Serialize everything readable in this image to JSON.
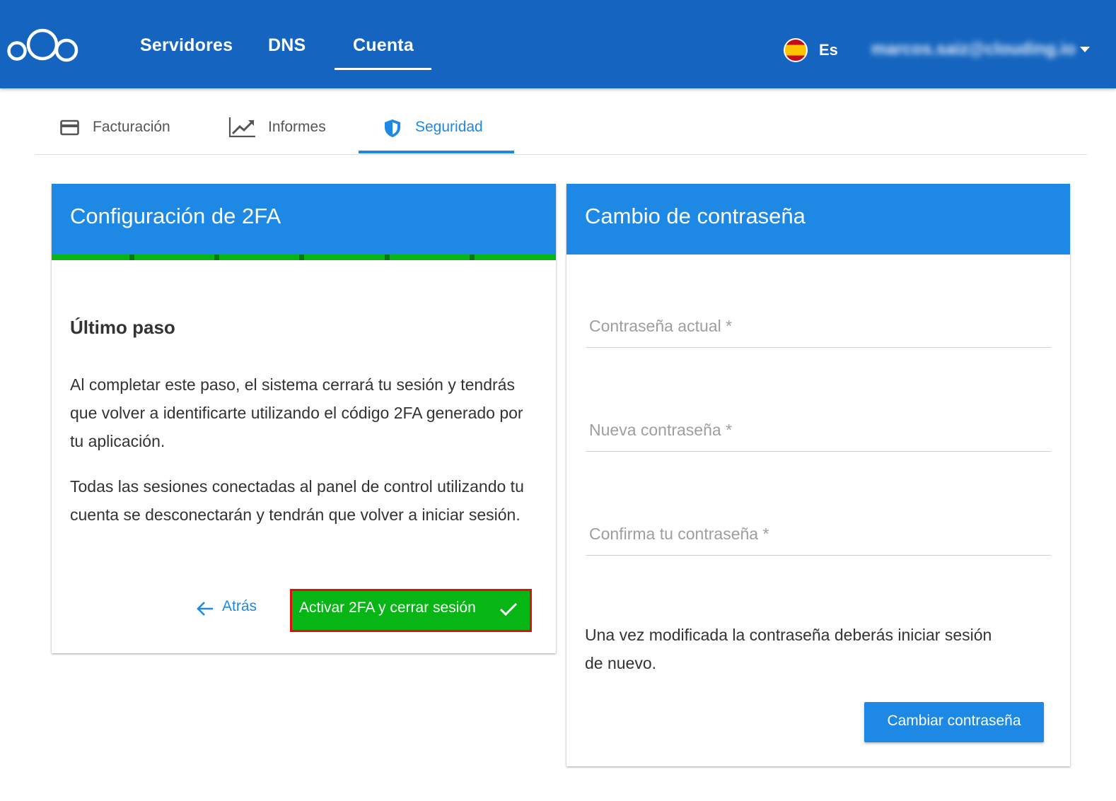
{
  "topbar": {
    "logo_icon": "cloud-circles-logo-icon",
    "nav": [
      {
        "label": "Servidores"
      },
      {
        "label": "DNS"
      },
      {
        "label": "Cuenta"
      }
    ],
    "active_nav": "Cuenta",
    "language": {
      "flag_icon": "spain-flag-icon",
      "label": "Es"
    },
    "user": {
      "email": "marcos.saiz@clouding.io",
      "caret_icon": "caret-down-icon"
    }
  },
  "subtabs": [
    {
      "label": "Facturación",
      "icon": "credit-card-icon"
    },
    {
      "label": "Informes",
      "icon": "trending-chart-icon"
    },
    {
      "label": "Seguridad",
      "icon": "shield-icon"
    }
  ],
  "active_subtab": "Seguridad",
  "twofa_card": {
    "title": "Configuración de 2FA",
    "progress_steps": 6,
    "progress_complete": 1.0,
    "step_title": "Último paso",
    "paragraphs": [
      "Al completar este paso, el sistema cerrará tu sesión y tendrás que volver a identificarte utilizando el código 2FA generado por tu aplicación.",
      "Todas las sesiones conectadas al panel de control utilizando tu cuenta se desconectarán y tendrán que volver a iniciar sesión."
    ],
    "back_label": "Atrás",
    "back_icon": "arrow-left-icon",
    "activate_label": "Activar 2FA y cerrar sesión",
    "activate_icon": "check-icon"
  },
  "password_card": {
    "title": "Cambio de contraseña",
    "fields": [
      {
        "placeholder": "Contraseña actual *",
        "value": ""
      },
      {
        "placeholder": "Nueva contraseña *",
        "value": ""
      },
      {
        "placeholder": "Confirma tu contraseña *",
        "value": ""
      }
    ],
    "note": "Una vez modificada la contraseña deberás iniciar sesión de nuevo.",
    "submit_label": "Cambiar contraseña"
  },
  "colors": {
    "topbar": "#1565c0",
    "accent": "#1e88e5",
    "success": "#07b515",
    "highlight_border": "#e01010"
  }
}
